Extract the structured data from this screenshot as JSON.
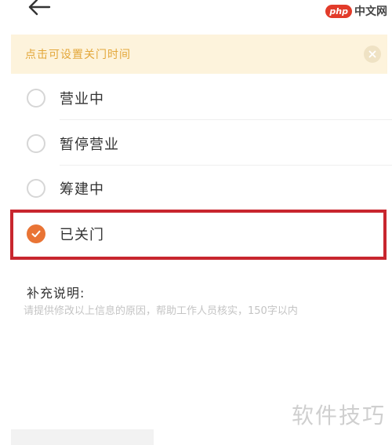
{
  "watermark_top": {
    "badge": "php",
    "text": "中文网"
  },
  "notice": {
    "text": "点击可设置关门时间"
  },
  "status_options": [
    {
      "label": "营业中",
      "checked": false
    },
    {
      "label": "暂停营业",
      "checked": false
    },
    {
      "label": "筹建中",
      "checked": false
    },
    {
      "label": "已关门",
      "checked": true
    }
  ],
  "remark": {
    "label": "补充说明:",
    "placeholder": "请提供修改以上信息的原因，帮助工作人员核实，150字以内"
  },
  "watermark_bottom": {
    "text": "软件技巧"
  },
  "colors": {
    "accent": "#e97435",
    "notice_bg": "#fdf3dc",
    "notice_text": "#e3a73a",
    "highlight_frame": "#c8262e"
  }
}
